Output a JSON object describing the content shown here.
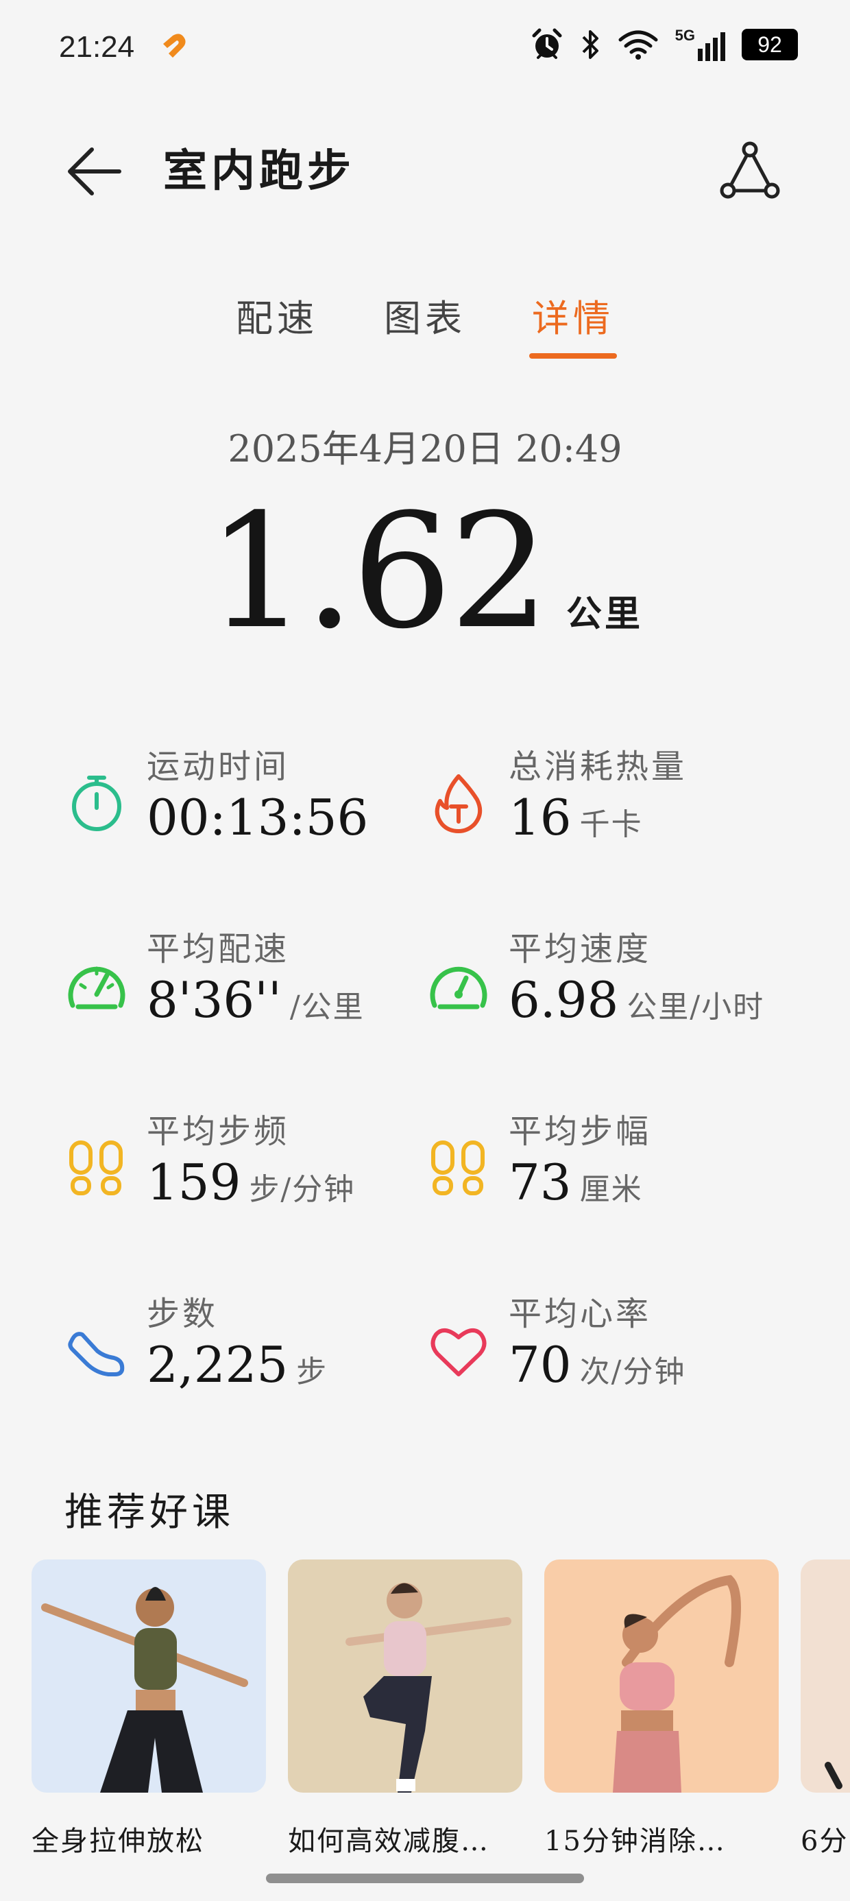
{
  "status_bar": {
    "time": "21:24",
    "network": "5G",
    "battery": "92",
    "icons": [
      "app-heart-icon",
      "alarm-icon",
      "bluetooth-icon",
      "wifi-icon",
      "signal-icon",
      "battery-icon"
    ]
  },
  "header": {
    "title": "室内跑步",
    "back_icon": "arrow-left-icon",
    "share_icon": "share-icon"
  },
  "tabs": [
    {
      "label": "配速",
      "active": false
    },
    {
      "label": "图表",
      "active": false
    },
    {
      "label": "详情",
      "active": true
    }
  ],
  "summary": {
    "datetime": "2025年4月20日  20:49",
    "distance": "1.62",
    "distance_unit": "公里"
  },
  "stats": [
    {
      "label": "运动时间",
      "value": "00:13:56",
      "unit": "",
      "icon": "stopwatch-icon",
      "color": "#2bbd8c"
    },
    {
      "label": "总消耗热量",
      "value": "16",
      "unit": "千卡",
      "icon": "flame-icon",
      "color": "#e8502a"
    },
    {
      "label": "平均配速",
      "value": "8'36''",
      "unit": "/公里",
      "icon": "pace-gauge-icon",
      "color": "#37c24a"
    },
    {
      "label": "平均速度",
      "value": "6.98",
      "unit": "公里/小时",
      "icon": "speed-gauge-icon",
      "color": "#37c24a"
    },
    {
      "label": "平均步频",
      "value": "159",
      "unit": "步/分钟",
      "icon": "footprints-icon",
      "color": "#f2b523"
    },
    {
      "label": "平均步幅",
      "value": "73",
      "unit": "厘米",
      "icon": "footprints-icon",
      "color": "#f2b523"
    },
    {
      "label": "步数",
      "value": "2,225",
      "unit": "步",
      "icon": "shoe-icon",
      "color": "#3a7bd5"
    },
    {
      "label": "平均心率",
      "value": "70",
      "unit": "次/分钟",
      "icon": "heart-icon",
      "color": "#e83a5a"
    }
  ],
  "courses": {
    "section_title": "推荐好课",
    "items": [
      {
        "title": "全身拉伸放松",
        "bg": "#dde8f7"
      },
      {
        "title": "如何高效减腹…",
        "bg": "#e2d2b4"
      },
      {
        "title": "15分钟消除…",
        "bg": "#f9cda8"
      },
      {
        "title": "6分…",
        "bg": "#f2e0d2"
      }
    ]
  },
  "colors": {
    "accent": "#ec6a1f",
    "background": "#f5f5f5"
  }
}
